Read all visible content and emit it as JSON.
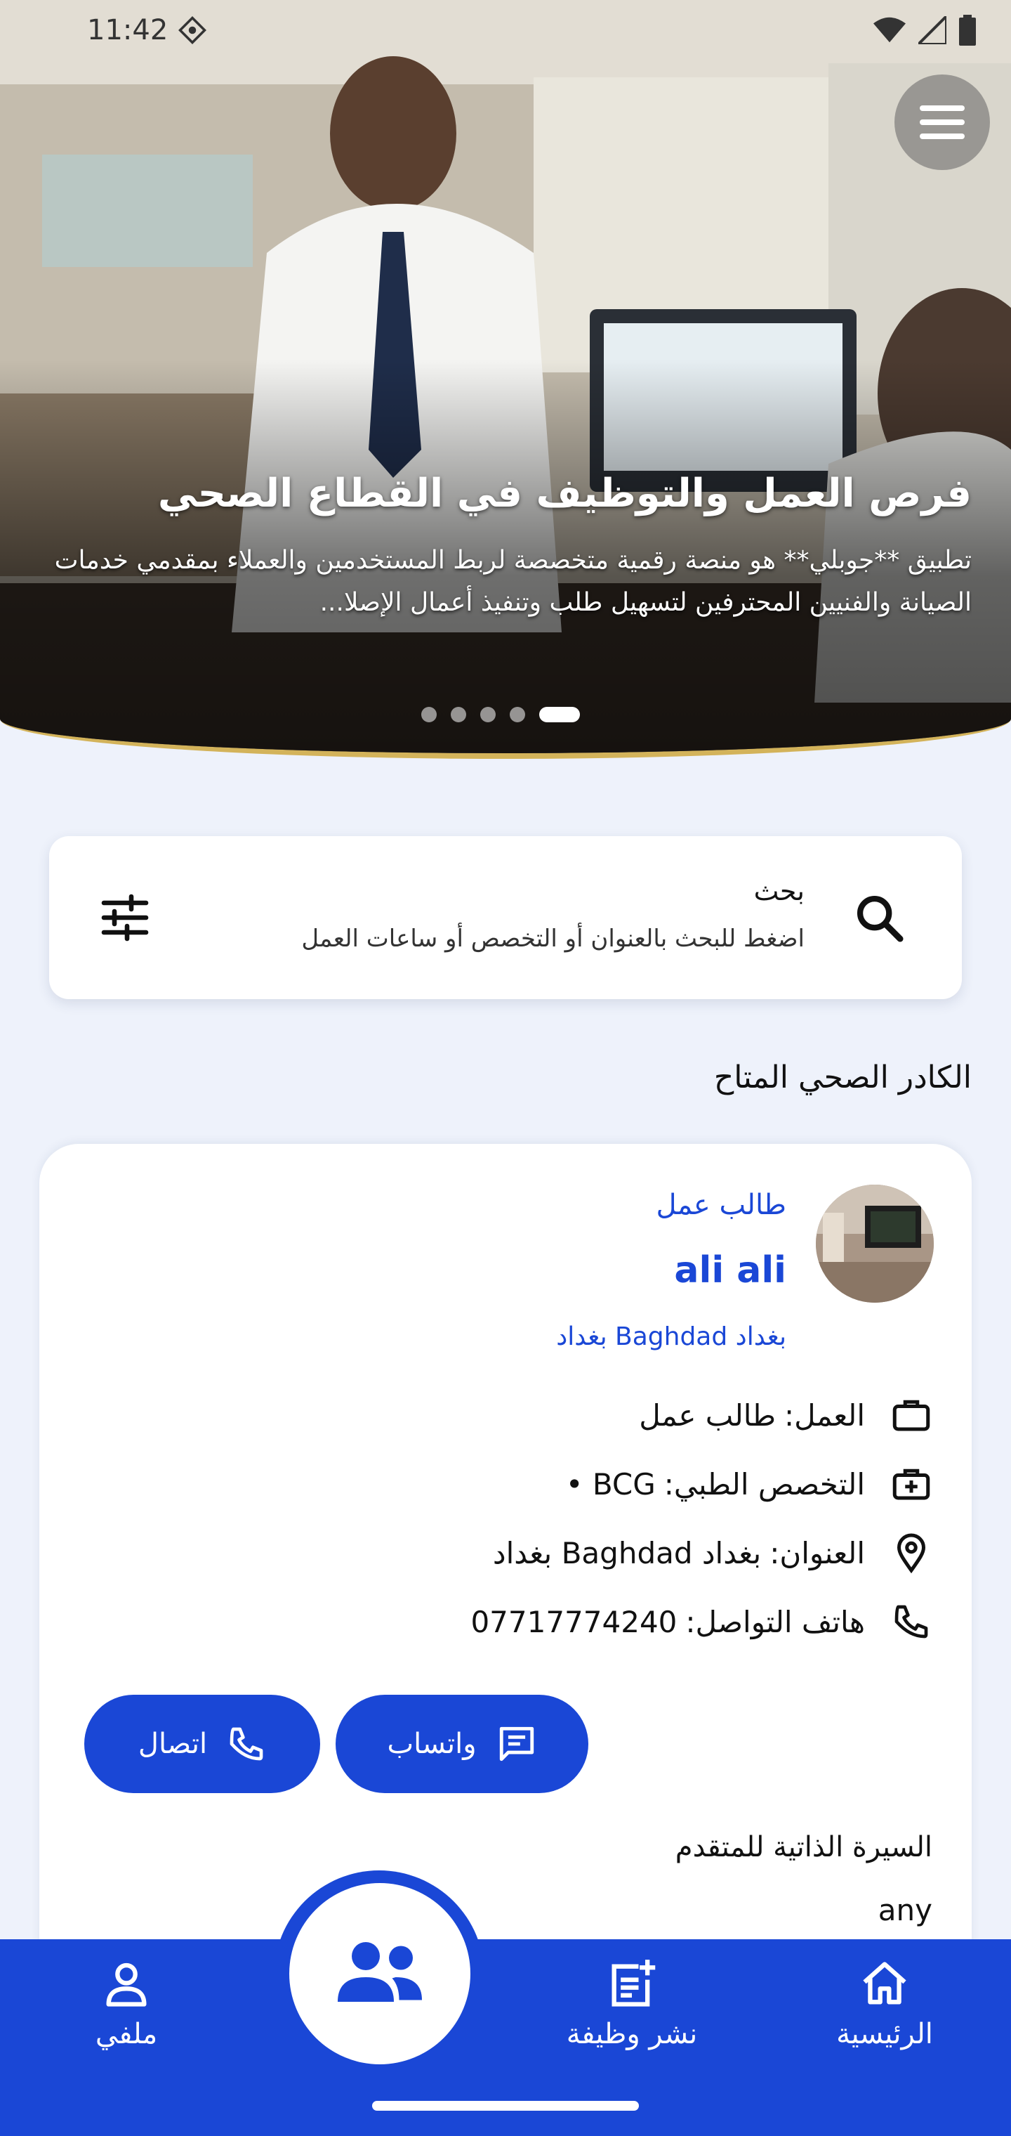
{
  "status_bar": {
    "time": "11:42"
  },
  "hero": {
    "title": "فرص العمل والتوظيف في القطاع الصحي",
    "description": "تطبيق **جوبلي** هو منصة رقمية متخصصة لربط المستخدمين والعملاء بمقدمي خدمات الصيانة والفنيين المحترفين لتسهيل طلب وتنفيذ أعمال الإصلا...",
    "slides_total": 5,
    "active_slide": 5
  },
  "search": {
    "title": "بحث",
    "hint": "اضغط للبحث بالعنوان أو التخصص أو ساعات العمل"
  },
  "section": {
    "title": "الكادر الصحي المتاح"
  },
  "profile": {
    "role": "طالب عمل",
    "name": "ali ali",
    "city": "بغداد Baghdad بغداد",
    "job_label": "العمل:",
    "job_value": "طالب عمل",
    "specialty_label": "التخصص الطبي:",
    "specialty_value": "BCG •",
    "address_label": "العنوان:",
    "address_value": "بغداد Baghdad بغداد",
    "phone_label": "هاتف التواصل:",
    "phone_value": "07717774240",
    "whatsapp_button": "واتساب",
    "call_button": "اتصال",
    "cv_title": "السيرة الذاتية للمتقدم",
    "cv_value": "any"
  },
  "bottom_nav": {
    "home": "الرئيسية",
    "post_job": "نشر وظيفة",
    "profile": "ملفي"
  },
  "colors": {
    "primary": "#1a47d6",
    "background": "#eef2fb",
    "hero_border": "#d3b35a"
  }
}
